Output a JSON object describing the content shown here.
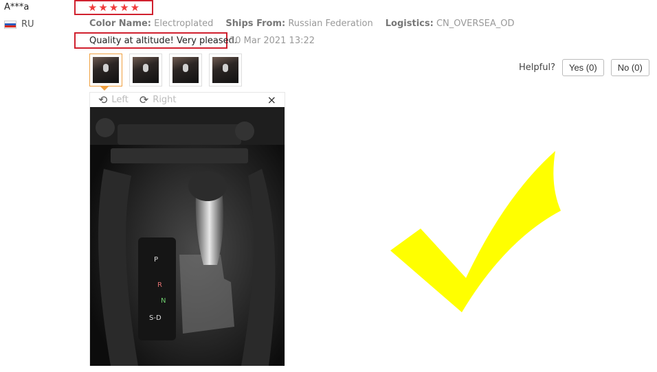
{
  "reviewer": {
    "name": "A***a",
    "country": "RU"
  },
  "rating": {
    "stars": 5,
    "max": 5
  },
  "meta": {
    "color_label": "Color Name:",
    "color_value": "Electroplated",
    "ships_label": "Ships From:",
    "ships_value": "Russian Federation",
    "logistics_label": "Logistics:",
    "logistics_value": "CN_OVERSEA_OD"
  },
  "review": {
    "text": "Quality at altitude! Very pleased.",
    "date": "10 Mar 2021 13:22"
  },
  "thumbnails": {
    "count": 4,
    "selected_index": 0
  },
  "viewer": {
    "rotate_left": "Left",
    "rotate_right": "Right",
    "close_symbol": "×"
  },
  "helpful": {
    "label": "Helpful?",
    "yes": "Yes (0)",
    "no": "No (0)"
  },
  "colors": {
    "highlight_border": "#d0202e",
    "star": "#f03a3a",
    "checkmark": "#ffff00",
    "thumb_active": "#f0a040"
  },
  "icons": {
    "rotate_left": "rotate-left-icon",
    "rotate_right": "rotate-right-icon",
    "close": "close-icon",
    "flag": "russia-flag-icon"
  }
}
